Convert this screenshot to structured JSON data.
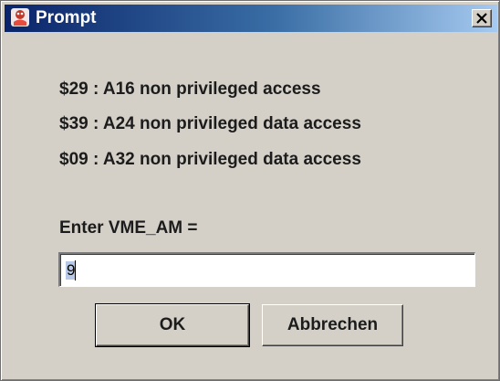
{
  "dialog": {
    "title": "Prompt",
    "messages": [
      "$29 : A16 non privileged access",
      "$39 : A24 non privileged data access",
      "$09 : A32 non privileged data access"
    ],
    "prompt_label": "Enter VME_AM =",
    "input_value": "9",
    "ok_label": "OK",
    "cancel_label": "Abbrechen"
  },
  "icons": {
    "window": "java-app-icon",
    "close": "close-icon"
  },
  "colors": {
    "titlebar_start": "#0a246a",
    "titlebar_end": "#a6caf0",
    "dialog_bg": "#d4d0c8",
    "selection": "#b8c8e8"
  }
}
